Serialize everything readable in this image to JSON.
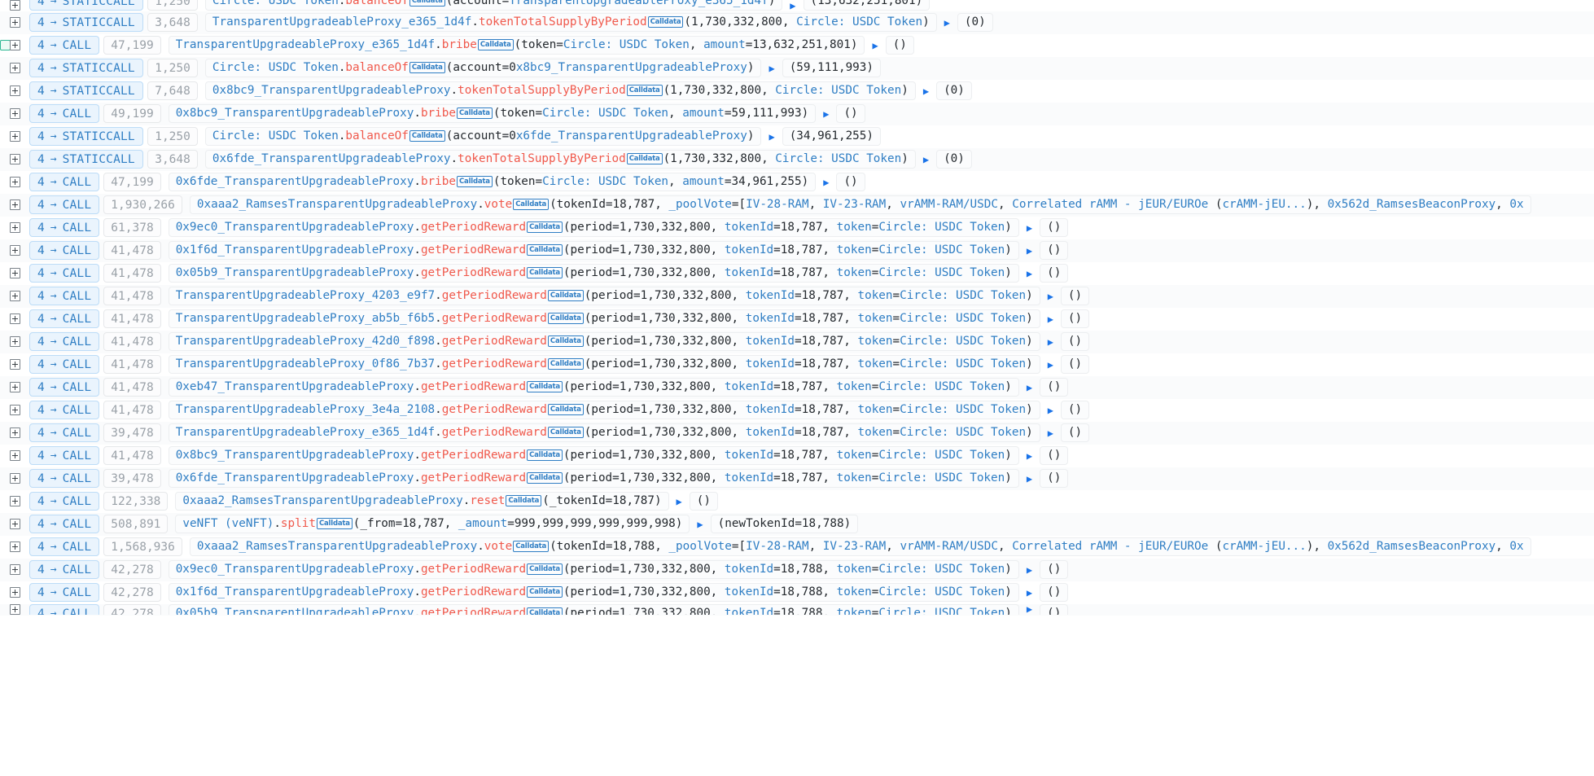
{
  "meta": {
    "view": "transaction-call-trace",
    "colors": {
      "contract": "#2f7ec4",
      "method": "#f0594c",
      "pill_border": "#bcdcf7",
      "pill_bg": "#eaf4fd",
      "gas_text": "#9aa1a8",
      "marker_green": "#2bb793",
      "return_arrow": "#1a73e8"
    },
    "calldata_label": "Calldata",
    "expander_icon": "plus-square-icon",
    "arrow_glyph": "→",
    "return_glyph": "▶"
  },
  "rows": [
    {
      "marker": false,
      "depth": "4",
      "calltype": "STATICCALL",
      "gas": "1,250",
      "contract": "Circle: USDC Token",
      "method": "balanceOf",
      "args": "(account=TransparentUpgradeableProxy_e365_1d4f)",
      "has_return": true,
      "ret": "(13,632,251,801)",
      "partial": "top"
    },
    {
      "marker": false,
      "depth": "4",
      "calltype": "STATICCALL",
      "gas": "3,648",
      "contract": "TransparentUpgradeableProxy_e365_1d4f",
      "method": "tokenTotalSupplyByPeriod",
      "args": "(1,730,332,800, Circle: USDC Token)",
      "has_return": true,
      "ret": "(0)"
    },
    {
      "marker": true,
      "depth": "4",
      "calltype": "CALL",
      "gas": "47,199",
      "contract": "TransparentUpgradeableProxy_e365_1d4f",
      "method": "bribe",
      "args": "(token=Circle: USDC Token, amount=13,632,251,801)",
      "has_return": true,
      "ret": "()"
    },
    {
      "marker": false,
      "depth": "4",
      "calltype": "STATICCALL",
      "gas": "1,250",
      "contract": "Circle: USDC Token",
      "method": "balanceOf",
      "args": "(account=0x8bc9_TransparentUpgradeableProxy)",
      "has_return": true,
      "ret": "(59,111,993)"
    },
    {
      "marker": false,
      "depth": "4",
      "calltype": "STATICCALL",
      "gas": "7,648",
      "contract": "0x8bc9_TransparentUpgradeableProxy",
      "method": "tokenTotalSupplyByPeriod",
      "args": "(1,730,332,800, Circle: USDC Token)",
      "has_return": true,
      "ret": "(0)"
    },
    {
      "marker": false,
      "depth": "4",
      "calltype": "CALL",
      "gas": "49,199",
      "contract": "0x8bc9_TransparentUpgradeableProxy",
      "method": "bribe",
      "args": "(token=Circle: USDC Token, amount=59,111,993)",
      "has_return": true,
      "ret": "()"
    },
    {
      "marker": false,
      "depth": "4",
      "calltype": "STATICCALL",
      "gas": "1,250",
      "contract": "Circle: USDC Token",
      "method": "balanceOf",
      "args": "(account=0x6fde_TransparentUpgradeableProxy)",
      "has_return": true,
      "ret": "(34,961,255)"
    },
    {
      "marker": false,
      "depth": "4",
      "calltype": "STATICCALL",
      "gas": "3,648",
      "contract": "0x6fde_TransparentUpgradeableProxy",
      "method": "tokenTotalSupplyByPeriod",
      "args": "(1,730,332,800, Circle: USDC Token)",
      "has_return": true,
      "ret": "(0)"
    },
    {
      "marker": false,
      "depth": "4",
      "calltype": "CALL",
      "gas": "47,199",
      "contract": "0x6fde_TransparentUpgradeableProxy",
      "method": "bribe",
      "args": "(token=Circle: USDC Token, amount=34,961,255)",
      "has_return": true,
      "ret": "()"
    },
    {
      "marker": false,
      "depth": "4",
      "calltype": "CALL",
      "gas": "1,930,266",
      "contract": "0xaaa2_RamsesTransparentUpgradeableProxy",
      "method": "vote",
      "args": "(tokenId=18,787, _poolVote=[IV-28-RAM, IV-23-RAM, vrAMM-RAM/USDC, Correlated rAMM - jEUR/EUROe (crAMM-jEU...), 0x562d_RamsesBeaconProxy, 0x",
      "has_return": false,
      "ret": ""
    },
    {
      "marker": false,
      "depth": "4",
      "calltype": "CALL",
      "gas": "61,378",
      "contract": "0x9ec0_TransparentUpgradeableProxy",
      "method": "getPeriodReward",
      "args": "(period=1,730,332,800, tokenId=18,787, token=Circle: USDC Token)",
      "has_return": true,
      "ret": "()"
    },
    {
      "marker": false,
      "depth": "4",
      "calltype": "CALL",
      "gas": "41,478",
      "contract": "0x1f6d_TransparentUpgradeableProxy",
      "method": "getPeriodReward",
      "args": "(period=1,730,332,800, tokenId=18,787, token=Circle: USDC Token)",
      "has_return": true,
      "ret": "()"
    },
    {
      "marker": false,
      "depth": "4",
      "calltype": "CALL",
      "gas": "41,478",
      "contract": "0x05b9_TransparentUpgradeableProxy",
      "method": "getPeriodReward",
      "args": "(period=1,730,332,800, tokenId=18,787, token=Circle: USDC Token)",
      "has_return": true,
      "ret": "()"
    },
    {
      "marker": false,
      "depth": "4",
      "calltype": "CALL",
      "gas": "41,478",
      "contract": "TransparentUpgradeableProxy_4203_e9f7",
      "method": "getPeriodReward",
      "args": "(period=1,730,332,800, tokenId=18,787, token=Circle: USDC Token)",
      "has_return": true,
      "ret": "()"
    },
    {
      "marker": false,
      "depth": "4",
      "calltype": "CALL",
      "gas": "41,478",
      "contract": "TransparentUpgradeableProxy_ab5b_f6b5",
      "method": "getPeriodReward",
      "args": "(period=1,730,332,800, tokenId=18,787, token=Circle: USDC Token)",
      "has_return": true,
      "ret": "()"
    },
    {
      "marker": false,
      "depth": "4",
      "calltype": "CALL",
      "gas": "41,478",
      "contract": "TransparentUpgradeableProxy_42d0_f898",
      "method": "getPeriodReward",
      "args": "(period=1,730,332,800, tokenId=18,787, token=Circle: USDC Token)",
      "has_return": true,
      "ret": "()"
    },
    {
      "marker": false,
      "depth": "4",
      "calltype": "CALL",
      "gas": "41,478",
      "contract": "TransparentUpgradeableProxy_0f86_7b37",
      "method": "getPeriodReward",
      "args": "(period=1,730,332,800, tokenId=18,787, token=Circle: USDC Token)",
      "has_return": true,
      "ret": "()"
    },
    {
      "marker": false,
      "depth": "4",
      "calltype": "CALL",
      "gas": "41,478",
      "contract": "0xeb47_TransparentUpgradeableProxy",
      "method": "getPeriodReward",
      "args": "(period=1,730,332,800, tokenId=18,787, token=Circle: USDC Token)",
      "has_return": true,
      "ret": "()"
    },
    {
      "marker": false,
      "depth": "4",
      "calltype": "CALL",
      "gas": "41,478",
      "contract": "TransparentUpgradeableProxy_3e4a_2108",
      "method": "getPeriodReward",
      "args": "(period=1,730,332,800, tokenId=18,787, token=Circle: USDC Token)",
      "has_return": true,
      "ret": "()"
    },
    {
      "marker": false,
      "depth": "4",
      "calltype": "CALL",
      "gas": "39,478",
      "contract": "TransparentUpgradeableProxy_e365_1d4f",
      "method": "getPeriodReward",
      "args": "(period=1,730,332,800, tokenId=18,787, token=Circle: USDC Token)",
      "has_return": true,
      "ret": "()"
    },
    {
      "marker": false,
      "depth": "4",
      "calltype": "CALL",
      "gas": "41,478",
      "contract": "0x8bc9_TransparentUpgradeableProxy",
      "method": "getPeriodReward",
      "args": "(period=1,730,332,800, tokenId=18,787, token=Circle: USDC Token)",
      "has_return": true,
      "ret": "()"
    },
    {
      "marker": false,
      "depth": "4",
      "calltype": "CALL",
      "gas": "39,478",
      "contract": "0x6fde_TransparentUpgradeableProxy",
      "method": "getPeriodReward",
      "args": "(period=1,730,332,800, tokenId=18,787, token=Circle: USDC Token)",
      "has_return": true,
      "ret": "()"
    },
    {
      "marker": false,
      "depth": "4",
      "calltype": "CALL",
      "gas": "122,338",
      "contract": "0xaaa2_RamsesTransparentUpgradeableProxy",
      "method": "reset",
      "args": "(_tokenId=18,787)",
      "has_return": true,
      "ret": "()"
    },
    {
      "marker": false,
      "depth": "4",
      "calltype": "CALL",
      "gas": "508,891",
      "contract": "veNFT (veNFT)",
      "method": "split",
      "args": "(_from=18,787, _amount=999,999,999,999,999,998)",
      "has_return": true,
      "ret": "(newTokenId=18,788)"
    },
    {
      "marker": false,
      "depth": "4",
      "calltype": "CALL",
      "gas": "1,568,936",
      "contract": "0xaaa2_RamsesTransparentUpgradeableProxy",
      "method": "vote",
      "args": "(tokenId=18,788, _poolVote=[IV-28-RAM, IV-23-RAM, vrAMM-RAM/USDC, Correlated rAMM - jEUR/EUROe (crAMM-jEU...), 0x562d_RamsesBeaconProxy, 0x",
      "has_return": false,
      "ret": ""
    },
    {
      "marker": false,
      "depth": "4",
      "calltype": "CALL",
      "gas": "42,278",
      "contract": "0x9ec0_TransparentUpgradeableProxy",
      "method": "getPeriodReward",
      "args": "(period=1,730,332,800, tokenId=18,788, token=Circle: USDC Token)",
      "has_return": true,
      "ret": "()"
    },
    {
      "marker": false,
      "depth": "4",
      "calltype": "CALL",
      "gas": "42,278",
      "contract": "0x1f6d_TransparentUpgradeableProxy",
      "method": "getPeriodReward",
      "args": "(period=1,730,332,800, tokenId=18,788, token=Circle: USDC Token)",
      "has_return": true,
      "ret": "()"
    },
    {
      "marker": false,
      "depth": "4",
      "calltype": "CALL",
      "gas": "42,278",
      "contract": "0x05b9_TransparentUpgradeableProxy",
      "method": "getPeriodReward",
      "args": "(period=1,730,332,800, tokenId=18,788, token=Circle: USDC Token)",
      "has_return": true,
      "ret": "()",
      "partial": "bottom"
    }
  ]
}
